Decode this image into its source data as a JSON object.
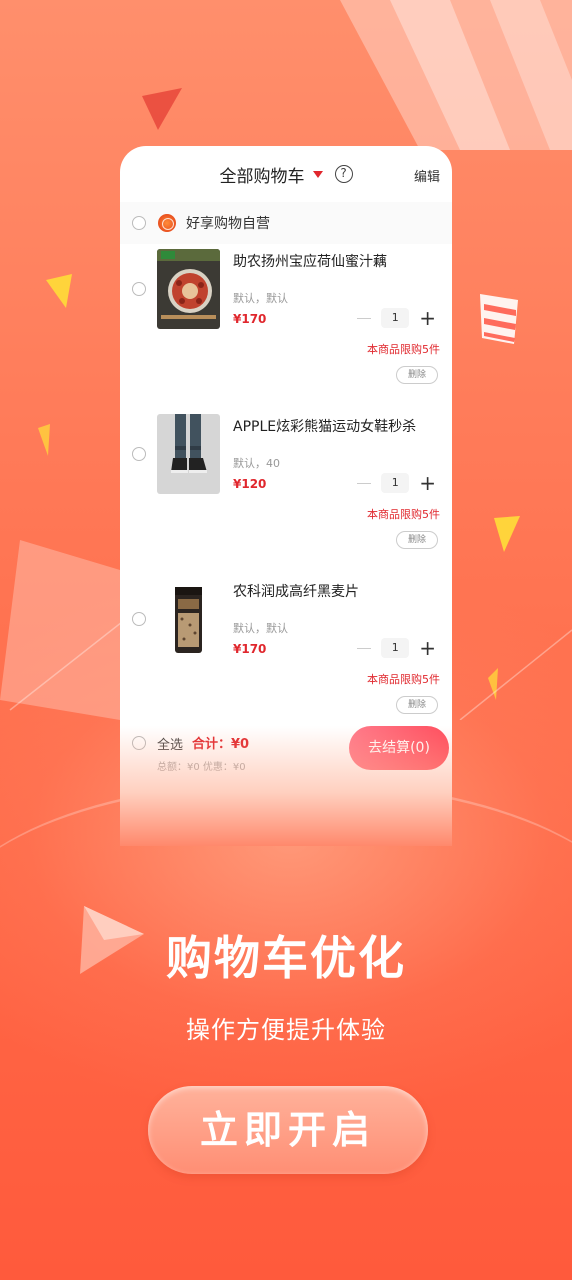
{
  "cart": {
    "title": "全部购物车",
    "help_glyph": "?",
    "edit_label": "编辑",
    "shop_name": "好享购物自营",
    "items": [
      {
        "name": "助农扬州宝应荷仙蜜汁藕",
        "spec": "默认，默认",
        "price": "¥170",
        "quantity": "1",
        "limit_note": "本商品限购5件",
        "delete_label": "删除",
        "thumb_icon": "lotus-root-dish"
      },
      {
        "name": "APPLE炫彩熊猫运动女鞋秒杀",
        "spec": "默认，40",
        "price": "¥120",
        "quantity": "1",
        "limit_note": "本商品限购5件",
        "delete_label": "删除",
        "thumb_icon": "sneakers-photo"
      },
      {
        "name": "农科润成高纤黑麦片",
        "spec": "默认，默认",
        "price": "¥170",
        "quantity": "1",
        "limit_note": "本商品限购5件",
        "delete_label": "删除",
        "thumb_icon": "oat-jar"
      }
    ],
    "footer": {
      "select_all": "全选",
      "total": "合计：¥0",
      "subtotal": "总额：¥0 优惠：¥0",
      "checkout": "去结算(0)"
    }
  },
  "promo": {
    "headline": "购物车优化",
    "subline": "操作方便提升体验",
    "button": "立即开启"
  },
  "colors": {
    "accent_red": "#e0272d",
    "background": "#ff6a48",
    "checkout_pink": "#ff4e5e"
  }
}
